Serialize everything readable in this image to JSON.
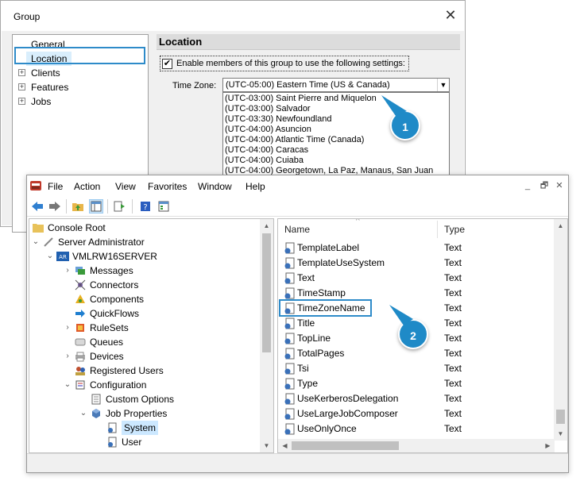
{
  "group_dialog": {
    "title": "Group",
    "close_glyph": "✕",
    "tree_items": [
      {
        "label": "General",
        "expandable": false,
        "selected": false
      },
      {
        "label": "Location",
        "expandable": false,
        "selected": true
      },
      {
        "label": "Clients",
        "expandable": true,
        "selected": false
      },
      {
        "label": "Features",
        "expandable": true,
        "selected": false
      },
      {
        "label": "Jobs",
        "expandable": true,
        "selected": false
      }
    ],
    "pane_title": "Location",
    "enable_checkbox": {
      "checked": true,
      "label": "Enable members of this group to use the following settings:"
    },
    "time_zone_label": "Time Zone:",
    "time_zone_value": "(UTC-05:00) Eastern Time (US & Canada)",
    "time_zone_options": [
      "(UTC-03:00) Saint Pierre and Miquelon",
      "(UTC-03:00) Salvador",
      "(UTC-03:30) Newfoundland",
      "(UTC-04:00) Asuncion",
      "(UTC-04:00) Atlantic Time (Canada)",
      "(UTC-04:00) Caracas",
      "(UTC-04:00) Cuiaba",
      "(UTC-04:00) Georgetown, La Paz, Manaus, San Juan"
    ]
  },
  "callouts": {
    "one": "1",
    "two": "2"
  },
  "mmc": {
    "menu": [
      "File",
      "Action",
      "View",
      "Favorites",
      "Window",
      "Help"
    ],
    "window_controls": {
      "minimize": "_",
      "restore": "🗗",
      "close": "✕"
    },
    "toolbar_icons": [
      "back-arrow-icon",
      "forward-arrow-icon",
      "up-folder-icon",
      "show-hide-tree-icon",
      "export-list-icon",
      "help-icon",
      "properties-icon"
    ],
    "tree": {
      "console_root": "Console Root",
      "server_admin": "Server Administrator",
      "server": "VMLRW16SERVER",
      "server_badge": "AR",
      "messages": "Messages",
      "connectors": "Connectors",
      "components": "Components",
      "quickflows": "QuickFlows",
      "rulesets": "RuleSets",
      "queues": "Queues",
      "devices": "Devices",
      "registered_users": "Registered Users",
      "configuration": "Configuration",
      "custom_options": "Custom Options",
      "job_properties": "Job Properties",
      "system": "System",
      "user": "User"
    },
    "list": {
      "col_name": "Name",
      "col_type": "Type",
      "rows": [
        {
          "name": "TemplateLabel",
          "type": "Text"
        },
        {
          "name": "TemplateUseSystem",
          "type": "Text"
        },
        {
          "name": "Text",
          "type": "Text"
        },
        {
          "name": "TimeStamp",
          "type": "Text"
        },
        {
          "name": "TimeZoneName",
          "type": "Text"
        },
        {
          "name": "Title",
          "type": "Text"
        },
        {
          "name": "TopLine",
          "type": "Text"
        },
        {
          "name": "TotalPages",
          "type": "Text"
        },
        {
          "name": "Tsi",
          "type": "Text"
        },
        {
          "name": "Type",
          "type": "Text"
        },
        {
          "name": "UseKerberosDelegation",
          "type": "Text"
        },
        {
          "name": "UseLargeJobComposer",
          "type": "Text"
        },
        {
          "name": "UseOnlyOnce",
          "type": "Text"
        }
      ]
    }
  },
  "colors": {
    "highlight": "#2e8bc9",
    "callout": "#1f8ac7"
  }
}
